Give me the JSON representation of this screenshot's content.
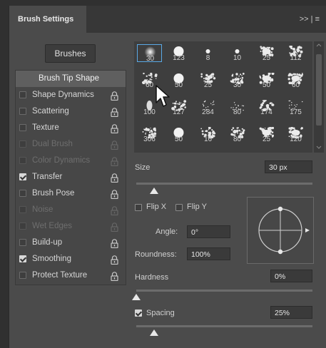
{
  "panel": {
    "title": "Brush Settings",
    "menu_icons": ">> | ≡"
  },
  "brushes_button": "Brushes",
  "left_items": [
    {
      "label": "Brush Tip Shape",
      "checkbox": false,
      "has_checkbox": false,
      "lock": false,
      "state": "selected"
    },
    {
      "label": "Shape Dynamics",
      "checkbox": false,
      "has_checkbox": true,
      "lock": true,
      "state": "normal"
    },
    {
      "label": "Scattering",
      "checkbox": false,
      "has_checkbox": true,
      "lock": true,
      "state": "normal"
    },
    {
      "label": "Texture",
      "checkbox": false,
      "has_checkbox": true,
      "lock": true,
      "state": "normal"
    },
    {
      "label": "Dual Brush",
      "checkbox": false,
      "has_checkbox": true,
      "lock": true,
      "state": "disabled"
    },
    {
      "label": "Color Dynamics",
      "checkbox": false,
      "has_checkbox": true,
      "lock": true,
      "state": "disabled"
    },
    {
      "label": "Transfer",
      "checkbox": true,
      "has_checkbox": true,
      "lock": true,
      "state": "normal"
    },
    {
      "label": "Brush Pose",
      "checkbox": false,
      "has_checkbox": true,
      "lock": true,
      "state": "normal"
    },
    {
      "label": "Noise",
      "checkbox": false,
      "has_checkbox": true,
      "lock": true,
      "state": "disabled"
    },
    {
      "label": "Wet Edges",
      "checkbox": false,
      "has_checkbox": true,
      "lock": true,
      "state": "disabled"
    },
    {
      "label": "Build-up",
      "checkbox": false,
      "has_checkbox": true,
      "lock": true,
      "state": "normal"
    },
    {
      "label": "Smoothing",
      "checkbox": true,
      "has_checkbox": true,
      "lock": true,
      "state": "normal"
    },
    {
      "label": "Protect Texture",
      "checkbox": false,
      "has_checkbox": true,
      "lock": true,
      "state": "normal"
    }
  ],
  "brush_presets": [
    {
      "size": "30",
      "tip": "soft-round",
      "selected": true
    },
    {
      "size": "123",
      "tip": "hard-round"
    },
    {
      "size": "8",
      "tip": "hard-round-small"
    },
    {
      "size": "10",
      "tip": "hard-round-small"
    },
    {
      "size": "25",
      "tip": "splatter"
    },
    {
      "size": "112",
      "tip": "spatter-texture"
    },
    {
      "size": "60",
      "tip": "spatter-texture"
    },
    {
      "size": "50",
      "tip": "hard-round"
    },
    {
      "size": "25",
      "tip": "spatter-texture"
    },
    {
      "size": "30",
      "tip": "spatter-texture"
    },
    {
      "size": "50",
      "tip": "splatter"
    },
    {
      "size": "60",
      "tip": "splatter"
    },
    {
      "size": "100",
      "tip": "leaf"
    },
    {
      "size": "127",
      "tip": "spatter-texture"
    },
    {
      "size": "284",
      "tip": "dots"
    },
    {
      "size": "80",
      "tip": "dots"
    },
    {
      "size": "174",
      "tip": "spatter-texture"
    },
    {
      "size": "175",
      "tip": "dots"
    },
    {
      "size": "306",
      "tip": "spatter-texture"
    },
    {
      "size": "50",
      "tip": "hard-round"
    },
    {
      "size": "16",
      "tip": "spatter-texture"
    },
    {
      "size": "80",
      "tip": "spatter-texture"
    },
    {
      "size": "25",
      "tip": "splatter"
    },
    {
      "size": "120",
      "tip": "splatter"
    }
  ],
  "size": {
    "label": "Size",
    "value": "30 px",
    "level": 0.1
  },
  "flip_x": {
    "label": "Flip X",
    "checked": false
  },
  "flip_y": {
    "label": "Flip Y",
    "checked": false
  },
  "angle": {
    "label": "Angle:",
    "value": "0°"
  },
  "roundness": {
    "label": "Roundness:",
    "value": "100%"
  },
  "hardness": {
    "label": "Hardness",
    "value": "0%",
    "level": 0.0
  },
  "spacing": {
    "label": "Spacing",
    "value": "25%",
    "checked": true,
    "level": 0.1
  },
  "colors": {
    "accent": "#5aa9e6",
    "panel": "#4b4b4b",
    "field": "#3a3a3a"
  }
}
